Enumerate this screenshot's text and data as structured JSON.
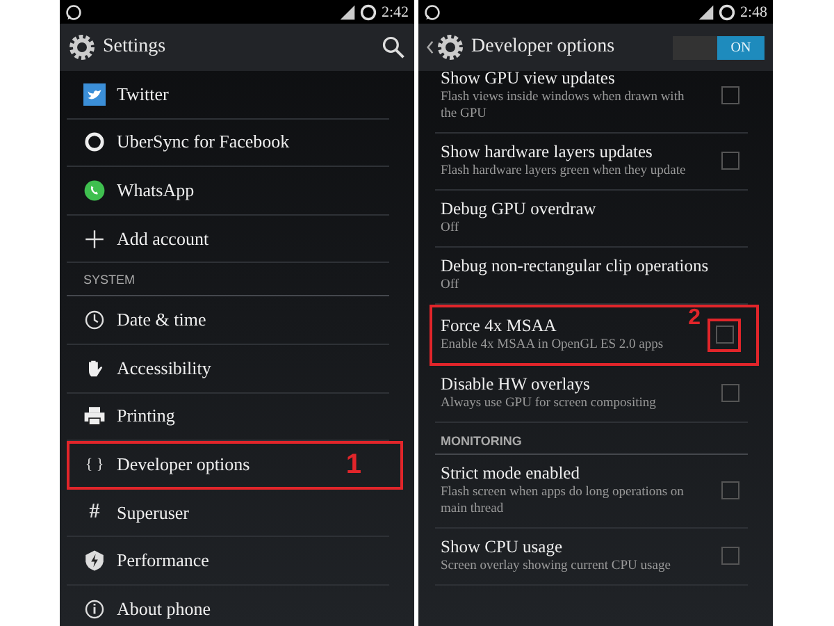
{
  "left_screen": {
    "status_bar": {
      "time": "2:42"
    },
    "action_bar": {
      "title": "Settings"
    },
    "items": [
      {
        "kind": "item",
        "label": "Twitter",
        "highlighted": false
      },
      {
        "kind": "item",
        "label": "UberSync for Facebook",
        "highlighted": false
      },
      {
        "kind": "item",
        "label": "WhatsApp",
        "highlighted": false
      },
      {
        "kind": "item",
        "label": "Add account",
        "highlighted": false
      },
      {
        "kind": "header",
        "label": "SYSTEM"
      },
      {
        "kind": "item",
        "label": "Date & time",
        "highlighted": false
      },
      {
        "kind": "item",
        "label": "Accessibility",
        "highlighted": false
      },
      {
        "kind": "item",
        "label": "Printing",
        "highlighted": false
      },
      {
        "kind": "glyph",
        "glyph": "{ }",
        "label": "Developer options",
        "highlighted": true,
        "callout": "1"
      },
      {
        "kind": "glyph",
        "glyph": "#",
        "label": "Superuser",
        "highlighted": false
      },
      {
        "kind": "item",
        "label": "Performance",
        "highlighted": false
      },
      {
        "kind": "item",
        "label": "About phone",
        "highlighted": false
      }
    ]
  },
  "right_screen": {
    "status_bar": {
      "time": "2:48"
    },
    "action_bar": {
      "title": "Developer options",
      "toggle": {
        "label": "ON",
        "on": true
      }
    },
    "items": [
      {
        "kind": "check",
        "title": "Show GPU view updates",
        "subtitle": "Flash views inside windows when drawn with the GPU",
        "checked": false,
        "highlighted": false
      },
      {
        "kind": "check",
        "title": "Show hardware layers updates",
        "subtitle": "Flash hardware layers green when they update",
        "checked": false,
        "highlighted": false
      },
      {
        "kind": "value",
        "title": "Debug GPU overdraw",
        "subtitle": "Off",
        "highlighted": false
      },
      {
        "kind": "value",
        "title": "Debug non-rectangular clip operations",
        "subtitle": "Off",
        "highlighted": false
      },
      {
        "kind": "check",
        "title": "Force 4x MSAA",
        "subtitle": "Enable 4x MSAA in OpenGL ES 2.0 apps",
        "checked": false,
        "highlighted": true,
        "callout": "2"
      },
      {
        "kind": "check",
        "title": "Disable HW overlays",
        "subtitle": "Always use GPU for screen compositing",
        "checked": false,
        "highlighted": false
      },
      {
        "kind": "header",
        "title": "MONITORING"
      },
      {
        "kind": "check",
        "title": "Strict mode enabled",
        "subtitle": "Flash screen when apps do long operations on main thread",
        "checked": false,
        "highlighted": false
      },
      {
        "kind": "check",
        "title": "Show CPU usage",
        "subtitle": "Screen overlay showing current CPU usage",
        "checked": false,
        "highlighted": false
      }
    ]
  }
}
